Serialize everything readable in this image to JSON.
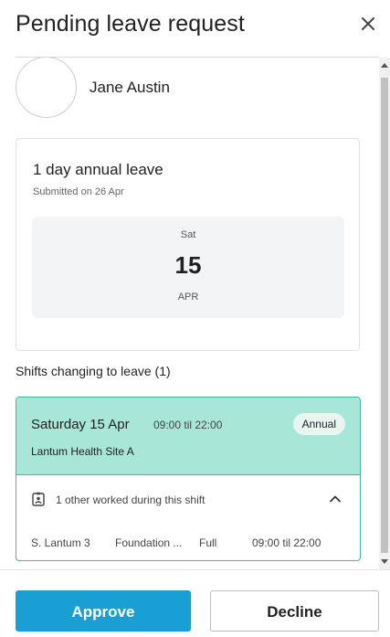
{
  "header": {
    "title": "Pending leave request",
    "close_icon": "close-icon"
  },
  "profile": {
    "name": "Jane Austin"
  },
  "leave": {
    "title": "1 day annual leave",
    "submitted": "Submitted on 26 Apr",
    "date": {
      "weekday": "Sat",
      "day": "15",
      "month": "APR"
    }
  },
  "shifts": {
    "heading": "Shifts changing to leave (1)",
    "items": [
      {
        "date": "Saturday 15 Apr",
        "time": "09:00 til 22:00",
        "badge": "Annual",
        "site": "Lantum Health Site A",
        "others_text": "1 other worked during this shift",
        "workers": [
          {
            "name": "S. Lantum 3",
            "role": "Foundation ...",
            "type": "Full",
            "time": "09:00 til 22:00"
          }
        ]
      }
    ]
  },
  "actions": {
    "approve": "Approve",
    "decline": "Decline"
  },
  "colors": {
    "accent": "#1a9fd4",
    "shift_bg": "#a8e6d8",
    "shift_border": "#3fb8a2"
  }
}
